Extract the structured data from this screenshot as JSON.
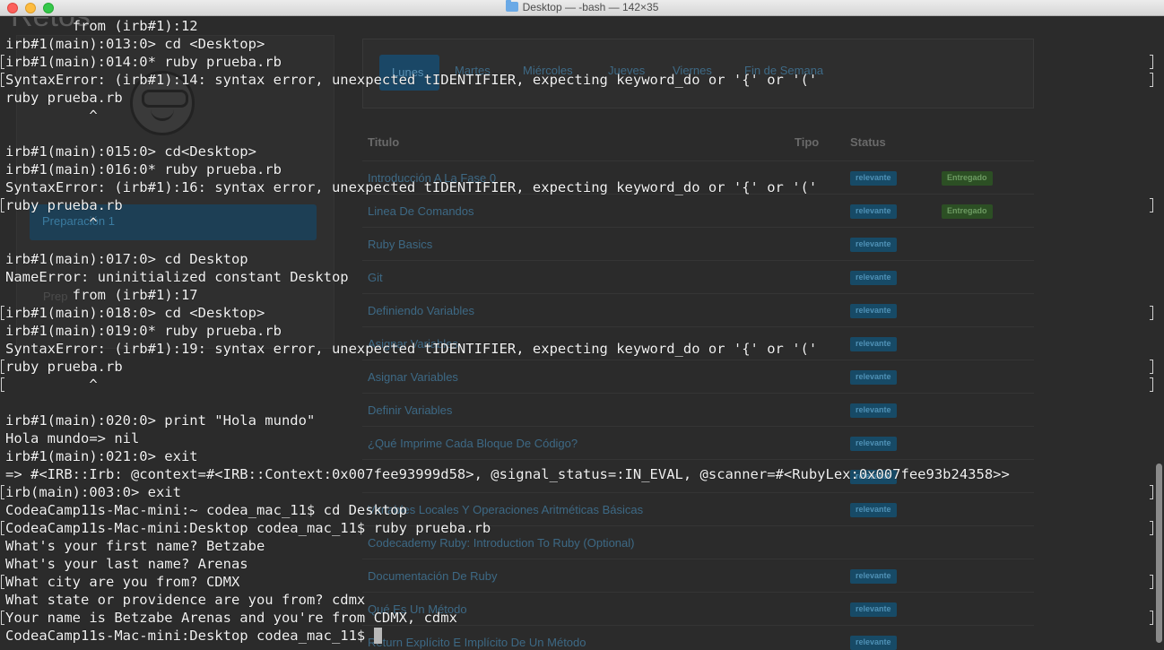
{
  "window": {
    "title": "Desktop — -bash — 142×35"
  },
  "background": {
    "page_title": "Retos",
    "side_button": "Preparación 1",
    "side_link": "Prep",
    "tabs": [
      "Lunes",
      "Martes",
      "Miércoles",
      "Jueves",
      "Viernes",
      "Fin de Semana"
    ],
    "table_headers": [
      "Titulo",
      "Tipo",
      "Status"
    ],
    "rows": [
      {
        "name": "Introducción A La Fase 0",
        "badge": "relevante",
        "status": "Entregado"
      },
      {
        "name": "Linea De Comandos",
        "badge": "relevante",
        "status": "Entregado"
      },
      {
        "name": "Ruby Basics",
        "badge": "relevante",
        "status": ""
      },
      {
        "name": "Git",
        "badge": "relevante",
        "status": ""
      },
      {
        "name": "Definiendo Variables",
        "badge": "relevante",
        "status": ""
      },
      {
        "name": "Asignar Variables",
        "badge": "relevante",
        "status": ""
      },
      {
        "name": "Asignar Variables",
        "badge": "relevante",
        "status": ""
      },
      {
        "name": "Definir Variables",
        "badge": "relevante",
        "status": ""
      },
      {
        "name": "¿Qué Imprime Cada Bloque De Código?",
        "badge": "relevante",
        "status": ""
      },
      {
        "name": "",
        "badge": "relevante",
        "status": ""
      },
      {
        "name": "Variables Locales Y Operaciones Aritméticas Básicas",
        "badge": "relevante",
        "status": ""
      },
      {
        "name": "Codecademy Ruby: Introduction To Ruby (Optional)",
        "badge": "",
        "status": ""
      },
      {
        "name": "Documentación De Ruby",
        "badge": "relevante",
        "status": ""
      },
      {
        "name": "Qué Es Un Método",
        "badge": "relevante",
        "status": ""
      },
      {
        "name": "Return Explícito E Implícito De Un Método",
        "badge": "relevante",
        "status": ""
      }
    ]
  },
  "terminal": {
    "lines": [
      "        from (irb#1):12",
      "irb#1(main):013:0> cd <Desktop>",
      "irb#1(main):014:0* ruby prueba.rb",
      "SyntaxError: (irb#1):14: syntax error, unexpected tIDENTIFIER, expecting keyword_do or '{' or '('",
      "ruby prueba.rb",
      "          ^",
      "",
      "irb#1(main):015:0> cd<Desktop>",
      "irb#1(main):016:0* ruby prueba.rb",
      "SyntaxError: (irb#1):16: syntax error, unexpected tIDENTIFIER, expecting keyword_do or '{' or '('",
      "ruby prueba.rb",
      "          ^",
      "",
      "irb#1(main):017:0> cd Desktop",
      "NameError: uninitialized constant Desktop",
      "        from (irb#1):17",
      "irb#1(main):018:0> cd <Desktop>",
      "irb#1(main):019:0* ruby prueba.rb",
      "SyntaxError: (irb#1):19: syntax error, unexpected tIDENTIFIER, expecting keyword_do or '{' or '('",
      "ruby prueba.rb",
      "          ^",
      "",
      "irb#1(main):020:0> print \"Hola mundo\"",
      "Hola mundo=> nil",
      "irb#1(main):021:0> exit",
      "=> #<IRB::Irb: @context=#<IRB::Context:0x007fee93999d58>, @signal_status=:IN_EVAL, @scanner=#<RubyLex:0x007fee93b24358>>",
      "irb(main):003:0> exit",
      "CodeaCamp11s-Mac-mini:~ codea_mac_11$ cd Desktop",
      "CodeaCamp11s-Mac-mini:Desktop codea_mac_11$ ruby prueba.rb",
      "What's your first name? Betzabe",
      "What's your last name? Arenas",
      "What city are you from? CDMX",
      "What state or providence are you from? cdmx",
      "Your name is Betzabe Arenas and you're from CDMX, cdmx",
      "CodeaCamp11s-Mac-mini:Desktop codea_mac_11$ "
    ]
  }
}
